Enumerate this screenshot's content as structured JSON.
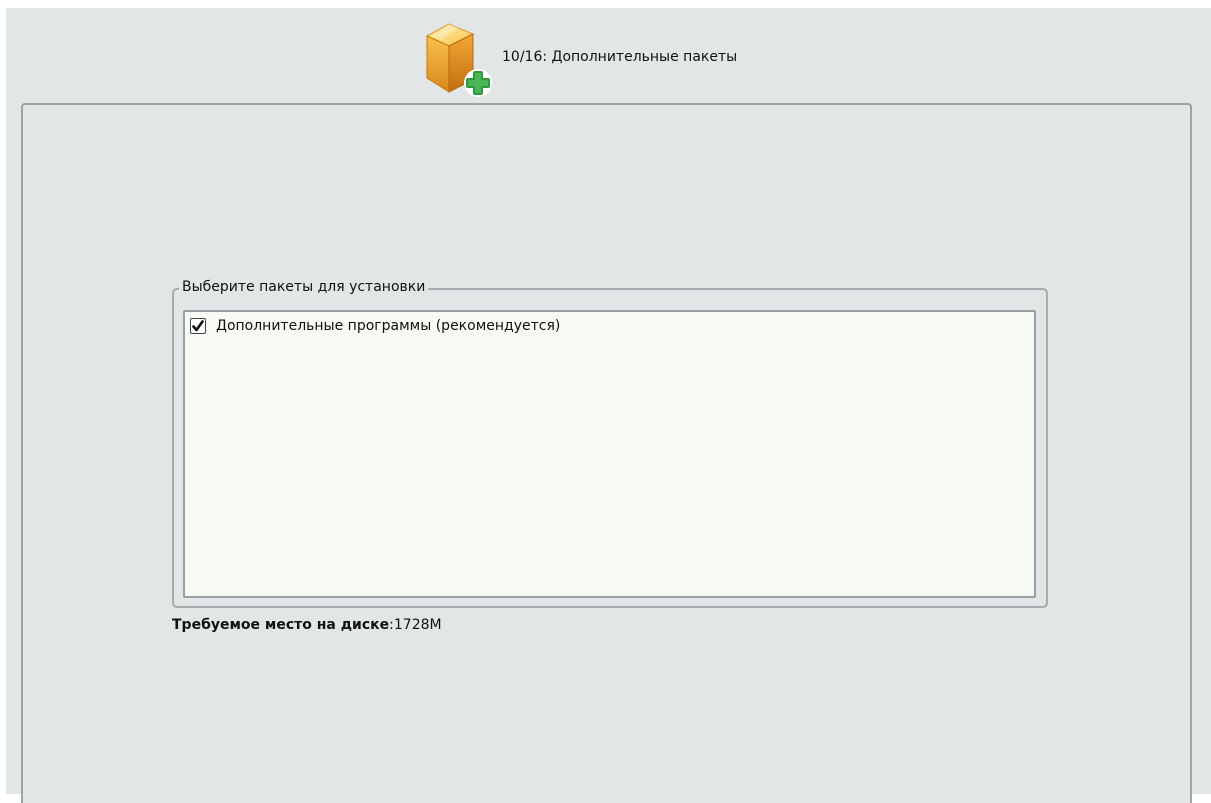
{
  "header": {
    "title": "10/16: Дополнительные пакеты",
    "icon": "package-add-icon"
  },
  "packages_group": {
    "legend": "Выберите пакеты для установки",
    "items": [
      {
        "label": "Дополнительные программы (рекомендуется)",
        "checked": true
      }
    ]
  },
  "disk_space": {
    "label": "Требуемое место на диске",
    "separator": ":",
    "value": "1728M"
  },
  "colors": {
    "background": "#e2e6e6",
    "list_background": "#f6f9f4",
    "icon_box": "#f2b43a",
    "icon_plus": "#2e9a3c"
  }
}
